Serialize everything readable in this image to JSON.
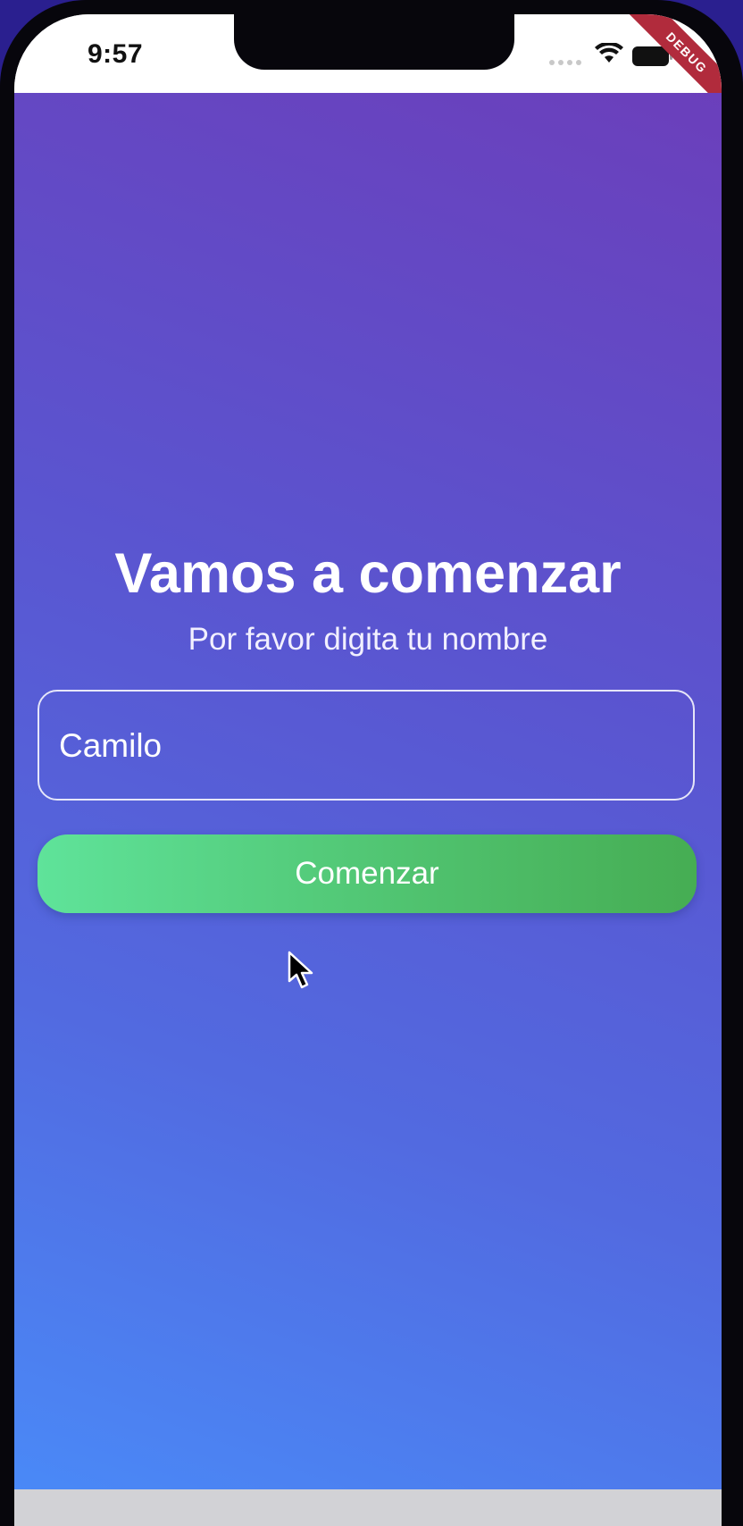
{
  "status_bar": {
    "time": "9:57",
    "icons": [
      "signal-dots-icon",
      "wifi-icon",
      "battery-icon"
    ]
  },
  "debug_banner": "DEBUG",
  "main": {
    "title": "Vamos a comenzar",
    "subtitle": "Por favor digita tu nombre",
    "name_input": {
      "value": "Camilo",
      "placeholder": ""
    },
    "start_button_label": "Comenzar"
  },
  "colors": {
    "gradient_top": "#6b3fbb",
    "gradient_bottom": "#4a89f7",
    "button_green_start": "#5fe39a",
    "button_green_end": "#46ad53",
    "debug_red": "#b12b3c"
  }
}
